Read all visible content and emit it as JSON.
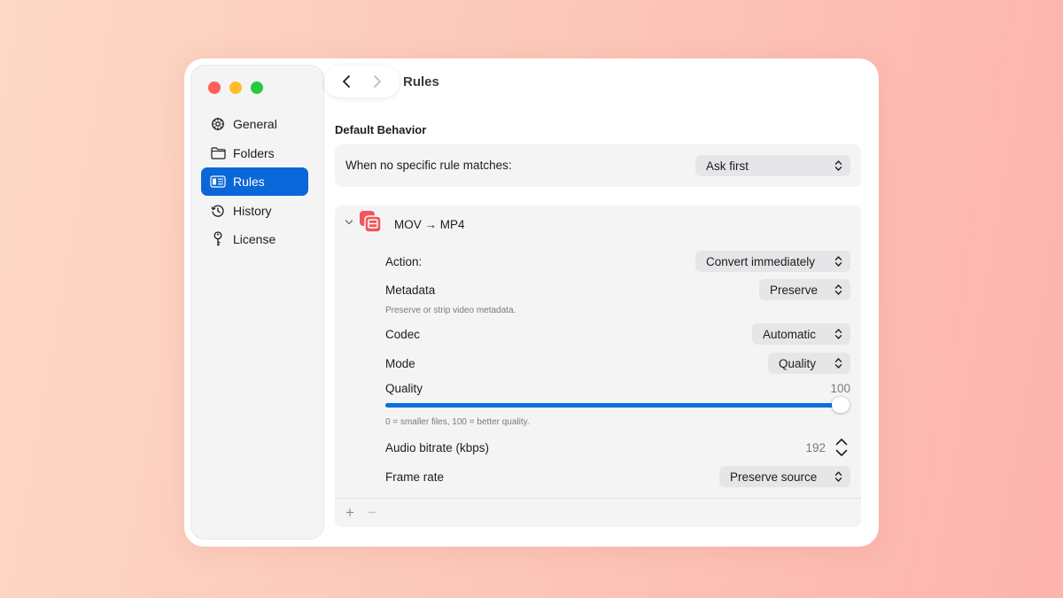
{
  "window": {
    "title": "Rules"
  },
  "sidebar": {
    "items": [
      {
        "label": "General",
        "icon": "gear-icon"
      },
      {
        "label": "Folders",
        "icon": "folder-icon"
      },
      {
        "label": "Rules",
        "icon": "list-icon",
        "active": true
      },
      {
        "label": "History",
        "icon": "clock-icon"
      },
      {
        "label": "License",
        "icon": "key-icon"
      }
    ]
  },
  "default_behavior": {
    "heading": "Default Behavior",
    "label": "When no specific rule matches:",
    "value": "Ask first"
  },
  "rule": {
    "name": "MOV → MP4",
    "icon": "video-convert-icon",
    "action_label": "Action:",
    "action_value": "Convert immediately",
    "metadata_label": "Metadata",
    "metadata_value": "Preserve",
    "metadata_help": "Preserve or strip video metadata.",
    "codec_label": "Codec",
    "codec_value": "Automatic",
    "mode_label": "Mode",
    "mode_value": "Quality",
    "quality_label": "Quality",
    "quality_value": "100",
    "quality_help": "0 = smaller files, 100 = better quality.",
    "audio_label": "Audio bitrate (kbps)",
    "audio_value": "192",
    "framerate_label": "Frame rate",
    "framerate_value": "Preserve source"
  },
  "footer": {
    "add": "+",
    "remove": "−"
  },
  "colors": {
    "accent": "#0a67d9",
    "rule_icon": "#f2565a"
  }
}
